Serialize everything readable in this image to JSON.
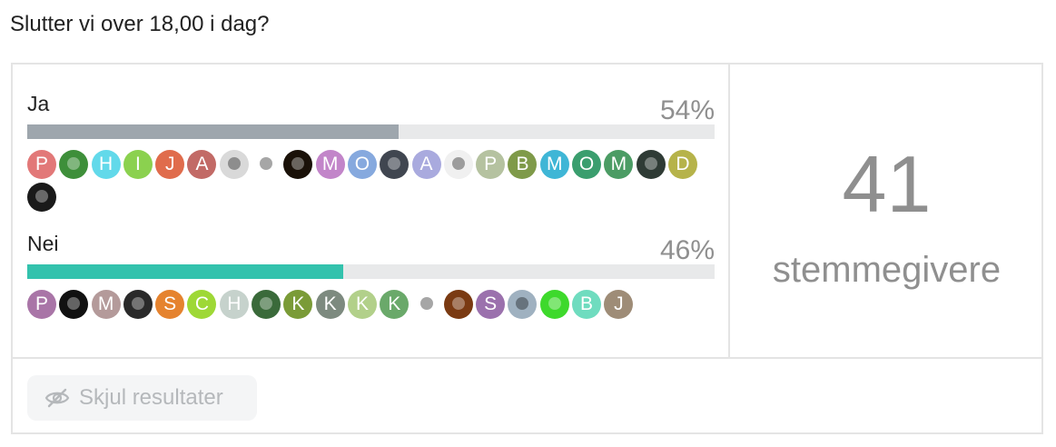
{
  "question": "Slutter vi over 18,00 i dag?",
  "voter_count": "41",
  "voter_label": "stemmegivere",
  "hide_results_label": "Skjul resultater",
  "hide_icon": "eye-slash-icon",
  "options": [
    {
      "label": "Ja",
      "percent_text": "54%",
      "percent": 54,
      "bar_color": "#9ea6ad",
      "voters": [
        {
          "initial": "P",
          "color": "#e27878"
        },
        {
          "initial": "",
          "color": "#3e8f3a",
          "type": "image"
        },
        {
          "initial": "H",
          "color": "#62d9ea"
        },
        {
          "initial": "I",
          "color": "#8bd14f"
        },
        {
          "initial": "J",
          "color": "#e06c4c"
        },
        {
          "initial": "A",
          "color": "#c26a66"
        },
        {
          "initial": "",
          "color": "#d9d9d9",
          "type": "image",
          "light": true
        },
        {
          "initial": "",
          "color": "#ffffff",
          "type": "image",
          "light": true
        },
        {
          "initial": "",
          "color": "#1a1108",
          "type": "image"
        },
        {
          "initial": "M",
          "color": "#c285c9"
        },
        {
          "initial": "O",
          "color": "#86a9de"
        },
        {
          "initial": "",
          "color": "#404650",
          "type": "image"
        },
        {
          "initial": "A",
          "color": "#a9aade"
        },
        {
          "initial": "",
          "color": "#f0f0f0",
          "type": "image",
          "light": true
        },
        {
          "initial": "P",
          "color": "#b5c2a0"
        },
        {
          "initial": "B",
          "color": "#7f9a49"
        },
        {
          "initial": "M",
          "color": "#3fb6d6"
        },
        {
          "initial": "O",
          "color": "#3a9e6e"
        },
        {
          "initial": "M",
          "color": "#4b9c64"
        },
        {
          "initial": "",
          "color": "#2f3b35",
          "type": "image"
        },
        {
          "initial": "D",
          "color": "#b6b34a"
        },
        {
          "initial": "",
          "color": "#1a1a1a",
          "type": "image"
        }
      ]
    },
    {
      "label": "Nei",
      "percent_text": "46%",
      "percent": 46,
      "bar_color": "#33c2ad",
      "voters": [
        {
          "initial": "P",
          "color": "#a975a7"
        },
        {
          "initial": "",
          "color": "#111111",
          "type": "image"
        },
        {
          "initial": "M",
          "color": "#b49a9a"
        },
        {
          "initial": "",
          "color": "#2a2a2a",
          "type": "image"
        },
        {
          "initial": "S",
          "color": "#e5832f"
        },
        {
          "initial": "C",
          "color": "#9ed836"
        },
        {
          "initial": "H",
          "color": "#c6d2cc"
        },
        {
          "initial": "",
          "color": "#3a6a3a",
          "type": "image"
        },
        {
          "initial": "K",
          "color": "#7a9b37"
        },
        {
          "initial": "K",
          "color": "#7d8a7f"
        },
        {
          "initial": "K",
          "color": "#b2d08a"
        },
        {
          "initial": "K",
          "color": "#6aa96a"
        },
        {
          "initial": "",
          "color": "#ffffff",
          "type": "image",
          "light": true
        },
        {
          "initial": "",
          "color": "#7a3a12",
          "type": "image"
        },
        {
          "initial": "S",
          "color": "#9b71ad"
        },
        {
          "initial": "",
          "color": "#9fb1c0",
          "type": "image",
          "light": true
        },
        {
          "initial": "",
          "color": "#3ed92c",
          "type": "image"
        },
        {
          "initial": "B",
          "color": "#6fdcbf"
        },
        {
          "initial": "J",
          "color": "#9e8c77"
        }
      ]
    }
  ]
}
